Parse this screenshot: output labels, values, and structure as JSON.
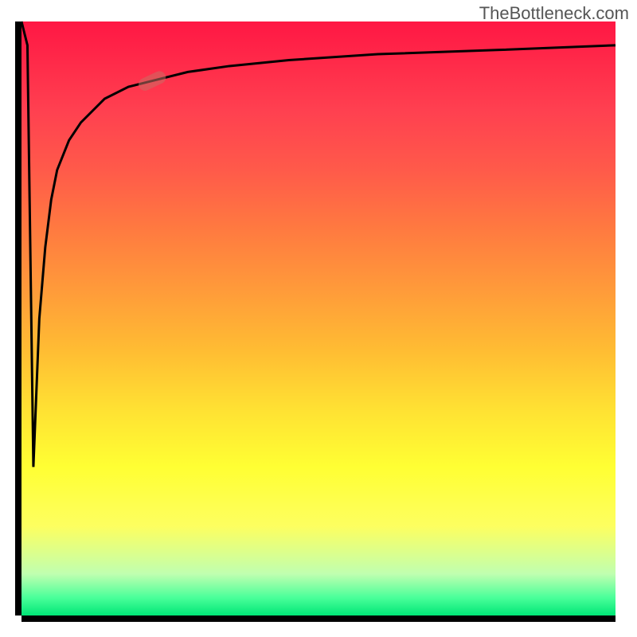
{
  "attribution": "TheBottleneck.com",
  "colors": {
    "gradient_top": "#ff1744",
    "gradient_mid": "#ffff33",
    "gradient_bottom": "#00e676",
    "axis": "#000000",
    "curve": "#000000",
    "marker": "rgba(200,110,100,0.55)"
  },
  "chart_data": {
    "type": "line",
    "title": "",
    "xlabel": "",
    "ylabel": "",
    "xlim": [
      0,
      100
    ],
    "ylim": [
      0,
      100
    ],
    "grid": false,
    "legend": false,
    "series": [
      {
        "name": "bottleneck-curve",
        "x": [
          0,
          1,
          2,
          3,
          4,
          5,
          6,
          8,
          10,
          14,
          18,
          22,
          28,
          35,
          45,
          60,
          80,
          100
        ],
        "y": [
          100,
          96,
          25,
          50,
          62,
          70,
          75,
          80,
          83,
          87,
          89,
          90,
          91.5,
          92.5,
          93.5,
          94.5,
          95.2,
          96
        ]
      }
    ],
    "marker": {
      "series": "bottleneck-curve",
      "x": 22,
      "y": 90,
      "shape": "rounded-rect",
      "angle_deg": 25
    },
    "notes": "Axis tick labels are not shown in the source image; x/y scales inferred as 0–100. Curve dips sharply near x≈2 then asymptotically approaches ~96."
  }
}
